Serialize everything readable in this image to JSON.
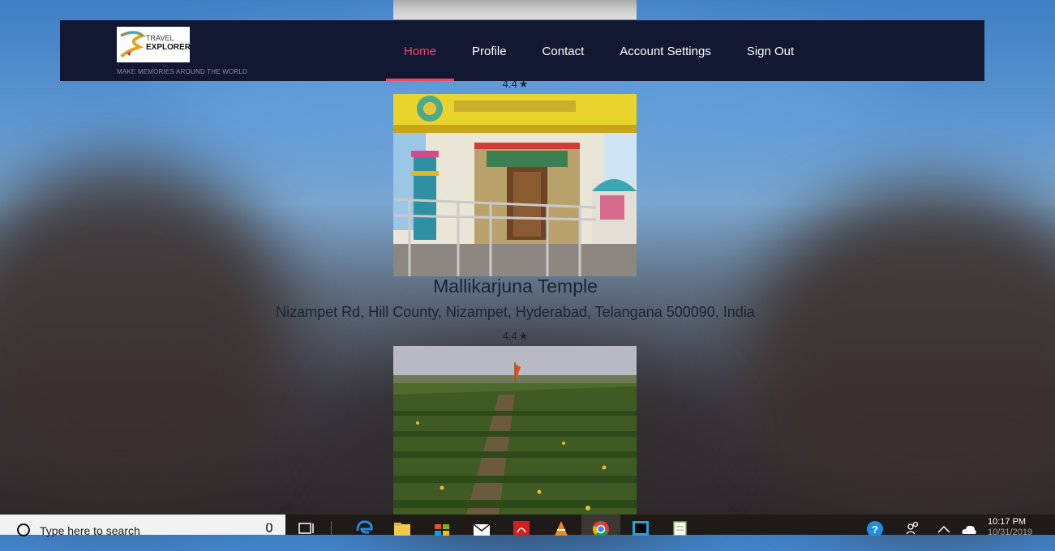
{
  "brand": {
    "logo_line1": "TRAVEL",
    "logo_line2": "EXPLORER",
    "tagline": "MAKE MEMORIES AROUND THE WORLD"
  },
  "nav": {
    "items": [
      {
        "label": "Home",
        "active": true
      },
      {
        "label": "Profile",
        "active": false
      },
      {
        "label": "Contact",
        "active": false
      },
      {
        "label": "Account Settings",
        "active": false
      },
      {
        "label": "Sign Out",
        "active": false
      }
    ]
  },
  "places": [
    {
      "rating": "4.4"
    },
    {
      "name": "Mallikarjuna Temple",
      "address": "Nizampet Rd, Hill County, Nizampet, Hyderabad, Telangana 500090, India",
      "rating": "4.4"
    }
  ],
  "taskbar": {
    "search_placeholder": "Type here to search",
    "time": "10:17 PM",
    "date": "10/31/2019"
  },
  "colors": {
    "navbar": "#131832",
    "accent": "#f0486b",
    "text": "#1b2330",
    "taskbar": "#1e1a17"
  }
}
